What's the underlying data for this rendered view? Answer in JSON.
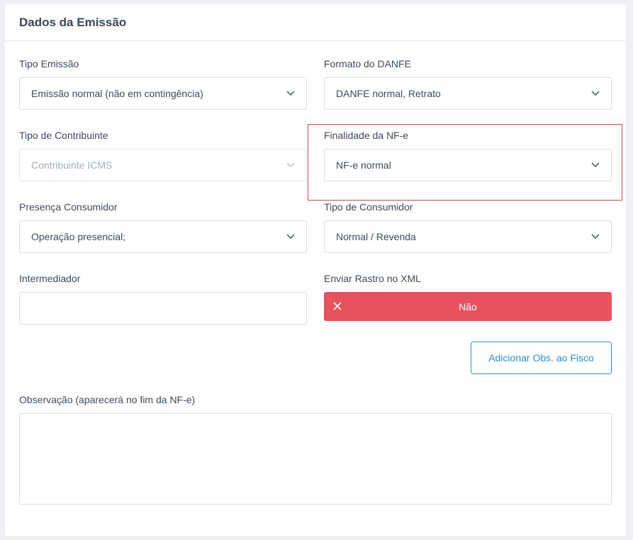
{
  "card": {
    "title": "Dados da Emissão"
  },
  "fields": {
    "tipo_emissao": {
      "label": "Tipo Emissão",
      "value": "Emissão normal (não em contingência)"
    },
    "formato_danfe": {
      "label": "Formato do DANFE",
      "value": "DANFE normal, Retrato"
    },
    "tipo_contribuinte": {
      "label": "Tipo de Contribuinte",
      "value": "Contribuinte ICMS"
    },
    "finalidade_nfe": {
      "label": "Finalidade da NF-e",
      "value": "NF-e normal"
    },
    "presenca_consumidor": {
      "label": "Presença Consumidor",
      "value": "Operação presencial;"
    },
    "tipo_consumidor": {
      "label": "Tipo de Consumidor",
      "value": "Normal / Revenda"
    },
    "intermediador": {
      "label": "Intermediador",
      "value": ""
    },
    "enviar_rastro": {
      "label": "Enviar Rastro no XML",
      "value": "Não"
    }
  },
  "buttons": {
    "adicionar_obs": "Adicionar Obs. ao Fisco"
  },
  "observacao": {
    "label": "Observação (aparecerá no fim da NF-e)",
    "value": ""
  },
  "colors": {
    "danger": "#e8525c",
    "primary": "#2a8fd6",
    "highlight": "#d64545"
  },
  "icons": {
    "select_arrow": "chevron-down-icon",
    "toggle_off": "close-icon"
  }
}
